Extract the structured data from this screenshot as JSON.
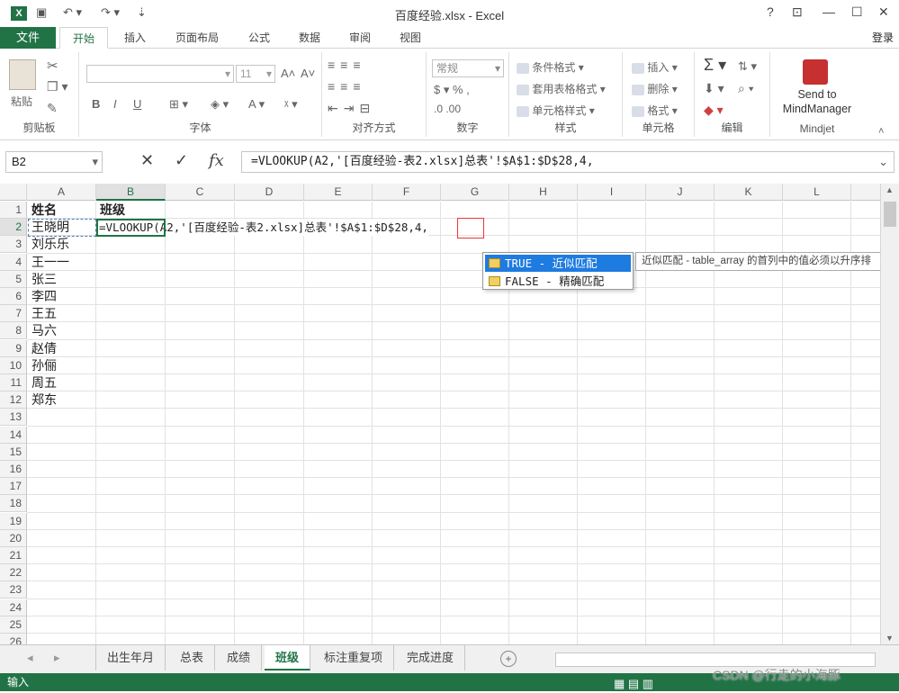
{
  "window": {
    "title": "百度经验.xlsx - Excel",
    "help": "?",
    "ribbon_display": "⊡",
    "minimize": "—",
    "maximize": "☐",
    "close": "✕"
  },
  "tabs": {
    "file": "文件",
    "items": [
      "开始",
      "插入",
      "页面布局",
      "公式",
      "数据",
      "审阅",
      "视图"
    ],
    "active": "开始",
    "login": "登录"
  },
  "ribbon": {
    "clipboard": {
      "paste": "粘贴",
      "label": "剪贴板"
    },
    "font": {
      "font_size": "11",
      "bold": "B",
      "italic": "I",
      "underline": "U",
      "grow": "A˄",
      "shrink": "A˅",
      "label": "字体"
    },
    "alignment": {
      "label": "对齐方式"
    },
    "number": {
      "format": "常规",
      "label": "数字"
    },
    "styles": {
      "conditional": "条件格式",
      "table": "套用表格格式",
      "cell": "单元格样式",
      "label": "样式"
    },
    "cells": {
      "insert": "插入",
      "delete": "删除",
      "format": "格式",
      "label": "单元格"
    },
    "editing": {
      "label": "编辑"
    },
    "mindjet": {
      "line1": "Send to",
      "line2": "MindManager",
      "label": "Mindjet"
    }
  },
  "formula_bar": {
    "name_box": "B2",
    "cancel": "✕",
    "enter": "✓",
    "fx": "fx",
    "formula": "=VLOOKUP(A2,'[百度经验-表2.xlsx]总表'!$A$1:$D$28,4,"
  },
  "columns": [
    "A",
    "B",
    "C",
    "D",
    "E",
    "F",
    "G",
    "H",
    "I",
    "J",
    "K",
    "L"
  ],
  "selected_column": "B",
  "rows": [
    "1",
    "2",
    "3",
    "4",
    "5",
    "6",
    "7",
    "8",
    "9",
    "10",
    "11",
    "12",
    "13",
    "14",
    "15",
    "16",
    "17",
    "18",
    "19",
    "20",
    "21",
    "22",
    "23",
    "24",
    "25",
    "26"
  ],
  "selected_row": "2",
  "headers": {
    "a1": "姓名",
    "b1": "班级"
  },
  "names": [
    "王晓明",
    "刘乐乐",
    "王一一",
    "张三",
    "李四",
    "王五",
    "马六",
    "赵倩",
    "孙俪",
    "周五",
    "郑东"
  ],
  "editing_formula": "=VLOOKUP(A2,'[百度经验-表2.xlsx]总表'!$A$1:$D$28,4,",
  "autocomplete": {
    "items": [
      "TRUE - 近似匹配",
      "FALSE - 精确匹配"
    ],
    "tooltip": "近似匹配 - table_array 的首列中的值必须以升序排"
  },
  "sheets": {
    "items": [
      "出生年月",
      "总表",
      "成绩",
      "班级",
      "标注重复项",
      "完成进度"
    ],
    "active": "班级",
    "add": "+"
  },
  "status": {
    "mode": "输入",
    "views": "▦ ▤ ▥"
  },
  "watermark": "CSDN @行走的小海豚"
}
